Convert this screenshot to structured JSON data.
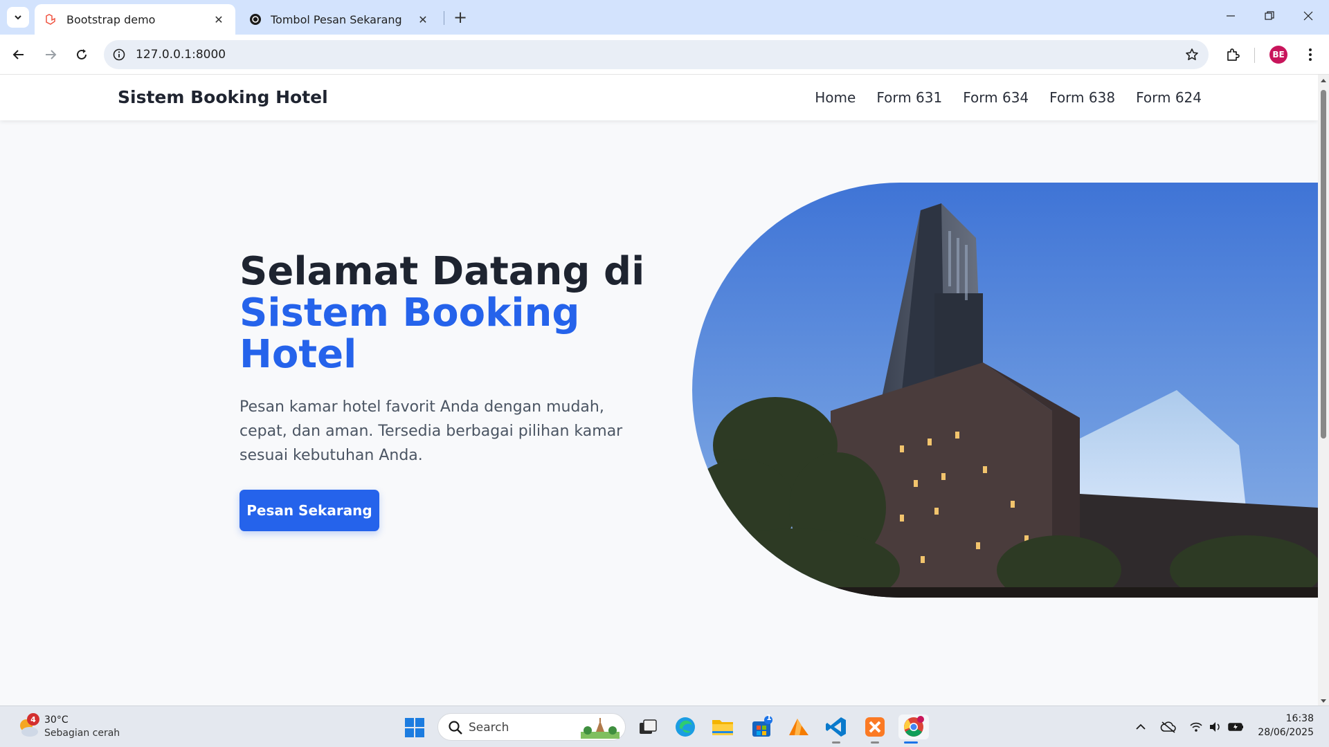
{
  "browser": {
    "tabs": [
      {
        "title": "Bootstrap demo",
        "active": true,
        "icon": "laravel-icon"
      },
      {
        "title": "Tombol Pesan Sekarang",
        "active": false,
        "icon": "chatgpt-icon"
      }
    ],
    "url": "127.0.0.1:8000",
    "profile_initials": "BE"
  },
  "site": {
    "brand": "Sistem Booking Hotel",
    "nav": [
      "Home",
      "Form 631",
      "Form 634",
      "Form 638",
      "Form 624"
    ]
  },
  "hero": {
    "title_line1": "Selamat Datang di",
    "title_accent": "Sistem Booking Hotel",
    "description": "Pesan kamar hotel favorit Anda dengan mudah, cepat, dan aman. Tersedia berbagai pilihan kamar sesuai kebutuhan Anda.",
    "button": "Pesan Sekarang",
    "accent_color": "#2563eb"
  },
  "taskbar": {
    "weather_temp": "30°C",
    "weather_desc": "Sebagian cerah",
    "weather_badge": "4",
    "search_label": "Search",
    "store_badge": "1",
    "time": "16:38",
    "date": "28/06/2025"
  }
}
